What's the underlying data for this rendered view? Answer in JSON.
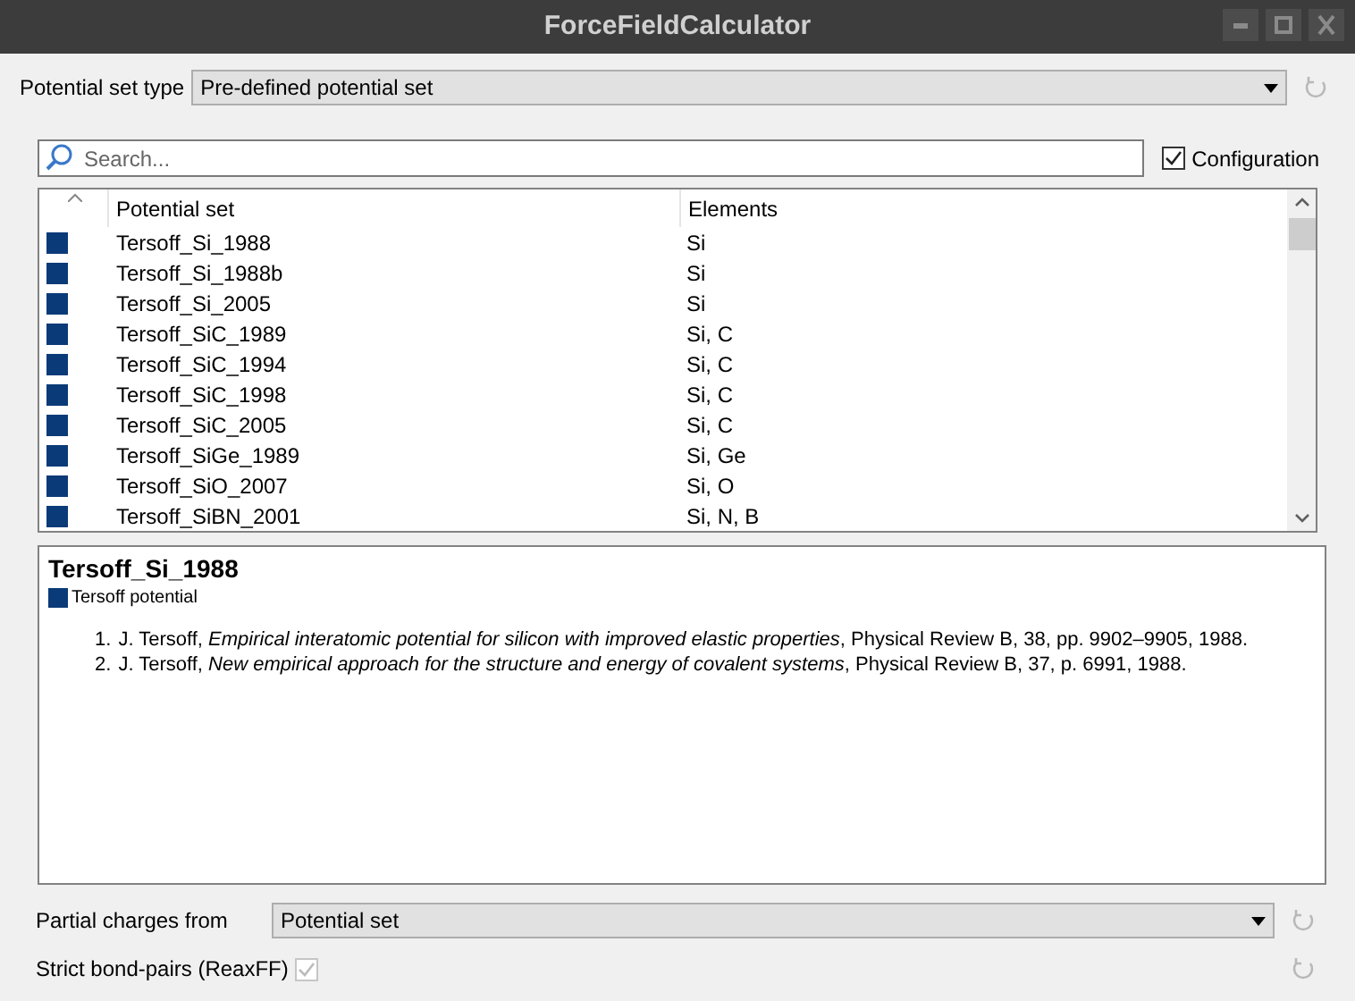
{
  "window": {
    "title": "ForceFieldCalculator"
  },
  "potential_set_type": {
    "label": "Potential set type",
    "value": "Pre-defined potential set"
  },
  "search": {
    "placeholder": "Search..."
  },
  "configuration": {
    "label": "Configuration",
    "checked": true
  },
  "table": {
    "columns": [
      "Potential set",
      "Elements"
    ],
    "rows": [
      {
        "name": "Tersoff_Si_1988",
        "elements": "Si",
        "color": "#0b3a78"
      },
      {
        "name": "Tersoff_Si_1988b",
        "elements": "Si",
        "color": "#0b3a78"
      },
      {
        "name": "Tersoff_Si_2005",
        "elements": "Si",
        "color": "#0b3a78"
      },
      {
        "name": "Tersoff_SiC_1989",
        "elements": "Si, C",
        "color": "#0b3a78"
      },
      {
        "name": "Tersoff_SiC_1994",
        "elements": "Si, C",
        "color": "#0b3a78"
      },
      {
        "name": "Tersoff_SiC_1998",
        "elements": "Si, C",
        "color": "#0b3a78"
      },
      {
        "name": "Tersoff_SiC_2005",
        "elements": "Si, C",
        "color": "#0b3a78"
      },
      {
        "name": "Tersoff_SiGe_1989",
        "elements": "Si, Ge",
        "color": "#0b3a78"
      },
      {
        "name": "Tersoff_SiO_2007",
        "elements": "Si, O",
        "color": "#0b3a78"
      },
      {
        "name": "Tersoff_SiBN_2001",
        "elements": "Si, N, B",
        "color": "#0b3a78"
      }
    ]
  },
  "details": {
    "title": "Tersoff_Si_1988",
    "legend": {
      "label": "Tersoff potential",
      "color": "#0b3a78"
    },
    "references": [
      {
        "number": "1.",
        "text": "J. Tersoff, *Empirical interatomic potential for silicon with improved elastic properties*, Physical Review B, 38, pp. 9902–9905, 1988."
      },
      {
        "number": "2.",
        "text": "J. Tersoff, *New empirical approach for the structure and energy of covalent systems*, Physical Review B, 37, p. 6991, 1988."
      }
    ]
  },
  "partial_charges": {
    "label": "Partial charges from",
    "value": "Potential set"
  },
  "strict_bond_pairs": {
    "label": "Strict bond-pairs (ReaxFF)",
    "checked": true,
    "disabled": true
  }
}
